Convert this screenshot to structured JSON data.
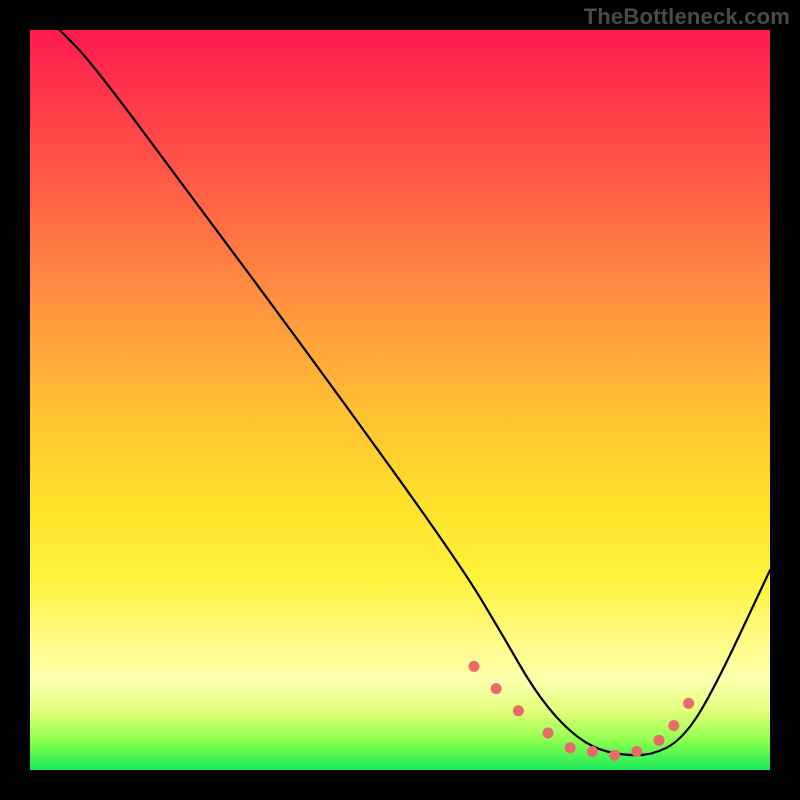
{
  "watermark": "TheBottleneck.com",
  "chart_data": {
    "type": "line",
    "title": "",
    "xlabel": "",
    "ylabel": "",
    "xlim": [
      0,
      100
    ],
    "ylim": [
      0,
      100
    ],
    "series": [
      {
        "name": "bottleneck-curve",
        "x": [
          4,
          8,
          20,
          40,
          58,
          64,
          68,
          72,
          76,
          80,
          84,
          88,
          92,
          100
        ],
        "values": [
          100,
          96,
          80,
          53,
          28,
          18,
          11,
          6,
          3,
          2,
          2,
          4,
          10,
          27
        ]
      }
    ],
    "markers": {
      "name": "highlight-dots",
      "color": "#e86a6a",
      "x": [
        60,
        63,
        66,
        70,
        73,
        76,
        79,
        82,
        85,
        87,
        89
      ],
      "values": [
        14,
        11,
        8,
        5,
        3,
        2.5,
        2,
        2.5,
        4,
        6,
        9
      ]
    },
    "background_gradient": {
      "top": "#ff1a4f",
      "upper_mid": "#ff963e",
      "mid": "#ffe12a",
      "lower_mid": "#fdffad",
      "bottom": "#18e858"
    }
  }
}
